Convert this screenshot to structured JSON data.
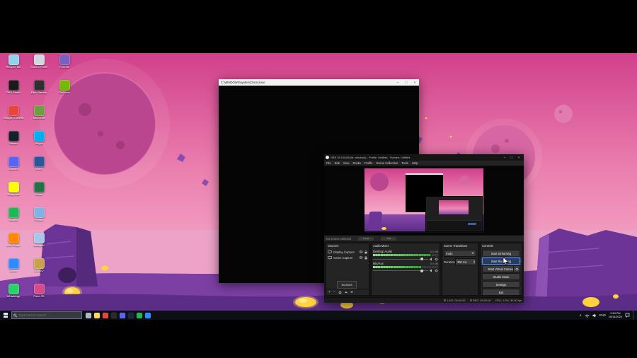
{
  "colors": {
    "taskbar": "#0c0f14",
    "obs_highlight": "#4d8af0",
    "meter_green": "#3fae3f",
    "sky_pink": "#e277ab",
    "rock_purple": "#6b3496",
    "stone_yellow": "#ffd23e"
  },
  "desktop_icons": [
    {
      "label": "Recycle Bin",
      "color": "#8fd3e8",
      "col": 0,
      "row": 0
    },
    {
      "label": "OBS Studio",
      "color": "#1b1b1b",
      "col": 0,
      "row": 1
    },
    {
      "label": "Google Chrome",
      "color": "#e8453c",
      "col": 0,
      "row": 2
    },
    {
      "label": "Steam",
      "color": "#16202d",
      "col": 0,
      "row": 3
    },
    {
      "label": "Discord",
      "color": "#5865f2",
      "col": 0,
      "row": 4
    },
    {
      "label": "Snapchat",
      "color": "#fffc00",
      "col": 0,
      "row": 5
    },
    {
      "label": "Spotify",
      "color": "#1db954",
      "col": 0,
      "row": 6
    },
    {
      "label": "VLC Player",
      "color": "#ff8800",
      "col": 0,
      "row": 7
    },
    {
      "label": "Zoom",
      "color": "#2d8cff",
      "col": 0,
      "row": 8
    },
    {
      "label": "WhatsApp",
      "color": "#25d366",
      "col": 0,
      "row": 9
    },
    {
      "label": "Control Panel",
      "color": "#cfd8dc",
      "col": 1,
      "row": 0
    },
    {
      "label": "Epic Games",
      "color": "#2f2f2f",
      "col": 1,
      "row": 1
    },
    {
      "label": "Minecraft",
      "color": "#6d9e3f",
      "col": 1,
      "row": 2
    },
    {
      "label": "Skype",
      "color": "#00aff0",
      "col": 1,
      "row": 3
    },
    {
      "label": "Word",
      "color": "#2b579a",
      "col": 1,
      "row": 4
    },
    {
      "label": "Excel",
      "color": "#217346",
      "col": 1,
      "row": 5
    },
    {
      "label": "Photos",
      "color": "#7fb2e5",
      "col": 1,
      "row": 6
    },
    {
      "label": "Notepad",
      "color": "#a8c6e8",
      "col": 1,
      "row": 7
    },
    {
      "label": "CS:GO",
      "color": "#c7a24a",
      "col": 1,
      "row": 8
    },
    {
      "label": "Paint 3D",
      "color": "#d84b8a",
      "col": 1,
      "row": 9
    },
    {
      "label": "Fortnite",
      "color": "#7a5fc0",
      "col": 2,
      "row": 0
    },
    {
      "label": "GeForce",
      "color": "#76b900",
      "col": 2,
      "row": 1
    }
  ],
  "cmd_window": {
    "title": "C:\\WINDOWS\\system32\\cmd.exe",
    "minimize": "–",
    "maximize": "□",
    "close": "×"
  },
  "obs": {
    "title": "OBS 25.0.8 (64-bit, windows) - Profile: Untitled - Scenes: Untitled",
    "minimize": "–",
    "maximize": "□",
    "close": "×",
    "menu": [
      "File",
      "Edit",
      "View",
      "Docks",
      "Profile",
      "Scene Collection",
      "Tools",
      "Help"
    ],
    "source_toolbar_status": "No source selected",
    "sources": {
      "title": "Sources",
      "dock_tab": "Sources",
      "items": [
        {
          "name": "Display Capture"
        },
        {
          "name": "Game Capture"
        }
      ]
    },
    "audio": {
      "title": "Audio Mixer",
      "tracks": [
        {
          "name": "Desktop Audio",
          "db": "0.0 dB",
          "level": 0.88
        },
        {
          "name": "Mic/Aux",
          "db": "0.0 dB",
          "level": 0.74
        }
      ]
    },
    "transitions": {
      "title": "Scene Transitions",
      "selected": "Fade",
      "duration_label": "Duration",
      "duration_value": "300 ms"
    },
    "controls": {
      "title": "Controls",
      "buttons": [
        {
          "label": "Start Streaming"
        },
        {
          "label": "Start Recording",
          "highlight": true
        },
        {
          "label": "Start Virtual Camera",
          "gear": true
        },
        {
          "label": "Studio Mode"
        },
        {
          "label": "Settings"
        },
        {
          "label": "Exit"
        }
      ]
    },
    "statusbar": {
      "live": "LIVE: 00:00:00",
      "rec": "REC: 00:00:00",
      "cpu": "CPU: 1.0%, 30.00 fps"
    }
  },
  "taskbar": {
    "search_placeholder": "Type here to search",
    "app_icons": [
      {
        "name": "task-view",
        "color": "#aeb8c2"
      },
      {
        "name": "file-explorer",
        "color": "#ffd75e"
      },
      {
        "name": "chrome",
        "color": "#e8453c"
      },
      {
        "name": "obs",
        "color": "#2b2b2b"
      },
      {
        "name": "discord",
        "color": "#5865f2"
      },
      {
        "name": "steam",
        "color": "#1b2838"
      },
      {
        "name": "spotify",
        "color": "#1db954"
      },
      {
        "name": "edge",
        "color": "#2d8cff"
      }
    ],
    "tray": {
      "chevron": "∧",
      "lang": "ENG",
      "time": "2:54 PM",
      "date": "10/14/2020"
    }
  }
}
